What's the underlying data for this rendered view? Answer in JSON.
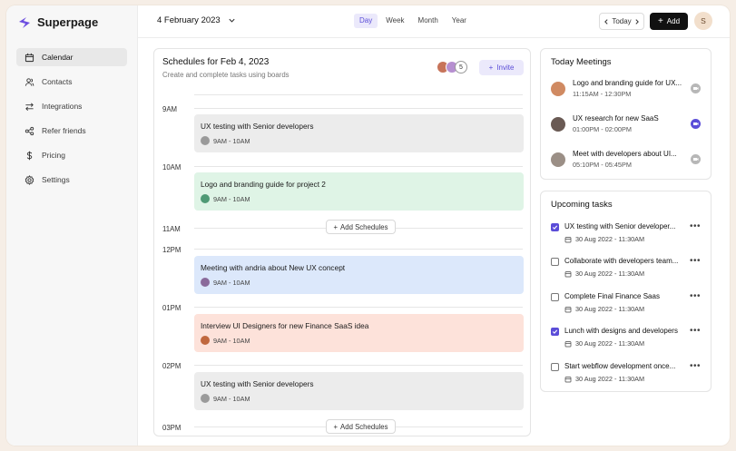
{
  "brand": {
    "name": "Superpage",
    "accent": "#5b4dd8"
  },
  "sidebar": {
    "items": [
      {
        "label": "Calendar",
        "icon": "calendar-icon",
        "active": true
      },
      {
        "label": "Contacts",
        "icon": "users-icon"
      },
      {
        "label": "Integrations",
        "icon": "swap-arrows-icon"
      },
      {
        "label": "Refer friends",
        "icon": "share-icon"
      },
      {
        "label": "Pricing",
        "icon": "dollar-icon"
      },
      {
        "label": "Settings",
        "icon": "gear-icon"
      }
    ]
  },
  "topbar": {
    "date": "4 February 2023",
    "views": [
      "Day",
      "Week",
      "Month",
      "Year"
    ],
    "active_view": "Day",
    "today_label": "Today",
    "add_label": "Add",
    "user_initial": "S"
  },
  "schedule": {
    "title": "Schedules for Feb 4, 2023",
    "subtitle": "Create and complete tasks using boards",
    "member_count": "5",
    "invite_label": "Invite",
    "add_schedules_label": "Add Schedules",
    "time_labels": [
      "9AM",
      "10AM",
      "11AM",
      "12PM",
      "01PM",
      "02PM",
      "03PM"
    ],
    "events": [
      {
        "title": "UX testing with Senior developers",
        "time": "9AM - 10AM",
        "color": "#ececec"
      },
      {
        "title": "Logo and branding guide for project 2",
        "time": "9AM - 10AM",
        "color": "#dff4e6"
      },
      {
        "title": "Meeting with andria about New UX concept",
        "time": "9AM - 10AM",
        "color": "#dce8fb"
      },
      {
        "title": "Interview UI Designers for new Finance SaaS idea",
        "time": "9AM - 10AM",
        "color": "#fde2da"
      },
      {
        "title": "UX testing with Senior developers",
        "time": "9AM - 10AM",
        "color": "#ececec"
      }
    ]
  },
  "today_meetings": {
    "title": "Today Meetings",
    "items": [
      {
        "title": "Logo and branding guide for UX...",
        "time": "11:15AM - 12:30PM",
        "active": false
      },
      {
        "title": "UX research for new SaaS",
        "time": "01:00PM - 02:00PM",
        "active": true
      },
      {
        "title": "Meet with developers about UI...",
        "time": "05:10PM - 05:45PM",
        "active": false
      }
    ]
  },
  "upcoming_tasks": {
    "title": "Upcoming tasks",
    "items": [
      {
        "title": "UX testing with Senior developer...",
        "date": "30 Aug 2022 - 11:30AM",
        "checked": true
      },
      {
        "title": "Collaborate with developers team...",
        "date": "30 Aug 2022 - 11:30AM",
        "checked": false
      },
      {
        "title": "Complete Final Finance Saas",
        "date": "30 Aug 2022 - 11:30AM",
        "checked": false
      },
      {
        "title": "Lunch with designs and developers",
        "date": "30 Aug 2022 - 11:30AM",
        "checked": true
      },
      {
        "title": "Start webflow development once...",
        "date": "30 Aug 2022 - 11:30AM",
        "checked": false
      }
    ]
  }
}
